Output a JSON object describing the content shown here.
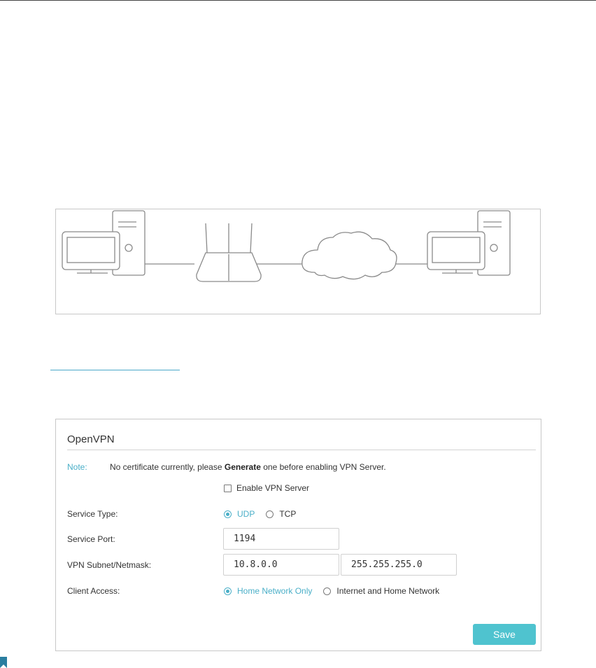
{
  "panel": {
    "title": "OpenVPN",
    "note_label": "Note:",
    "note_before": "No certificate currently, please ",
    "note_bold": "Generate",
    "note_after": " one before enabling VPN Server.",
    "enable_label": "Enable VPN Server",
    "enable_checked": false,
    "service_type": {
      "label": "Service Type:",
      "options": [
        "UDP",
        "TCP"
      ],
      "selected": "UDP"
    },
    "service_port": {
      "label": "Service Port:",
      "value": "1194"
    },
    "vpn_subnet": {
      "label": "VPN Subnet/Netmask:",
      "subnet": "10.8.0.0",
      "netmask": "255.255.255.0"
    },
    "client_access": {
      "label": "Client Access:",
      "options": [
        "Home Network Only",
        "Internet and Home Network"
      ],
      "selected": "Home Network Only"
    },
    "save_label": "Save"
  },
  "icons": {
    "diagram": [
      "desktop-computer-icon",
      "router-icon",
      "cloud-icon",
      "desktop-computer-icon"
    ],
    "corner": "bookmark-icon"
  },
  "colors": {
    "accent": "#4aafc8",
    "button": "#4fc3cf"
  }
}
